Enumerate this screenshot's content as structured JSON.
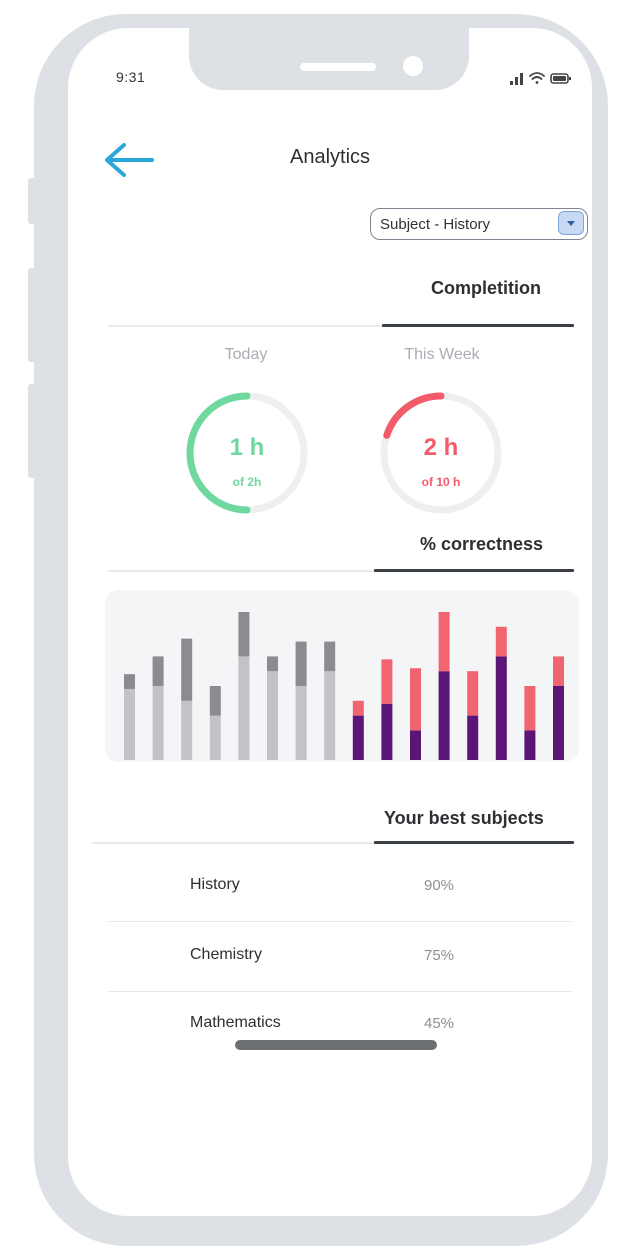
{
  "status_bar": {
    "time": "9:31",
    "icons": [
      "signal-icon",
      "wifi-icon",
      "battery-icon"
    ]
  },
  "header": {
    "title": "Analytics",
    "back_icon": "arrow-left-icon"
  },
  "subject_select": {
    "selected": "Subject - History"
  },
  "completion": {
    "title": "Completition",
    "today": {
      "label": "Today",
      "value": "1 h",
      "sub": "of 2h",
      "fraction": 0.5,
      "color": "#6fd89e"
    },
    "week": {
      "label": "This Week",
      "value": "2 h",
      "sub": "of 10 h",
      "fraction": 0.2,
      "color": "#f25c6a"
    }
  },
  "correctness": {
    "title": "% correctness"
  },
  "chart_data": {
    "type": "bar",
    "stacked": true,
    "axes_visible": false,
    "ylim": [
      0,
      100
    ],
    "groups": [
      {
        "name": "previous",
        "bar_count": 8,
        "colors": [
          "#c1c3c6",
          "#8a8c8f"
        ]
      },
      {
        "name": "current",
        "bar_count": 8,
        "colors": [
          "#5a1577",
          "#f16570"
        ]
      }
    ],
    "series": [
      {
        "values": [
          48,
          50,
          40,
          30,
          70,
          60,
          50,
          60,
          30,
          38,
          20,
          60,
          30,
          70,
          20,
          50
        ]
      },
      {
        "values": [
          10,
          20,
          42,
          20,
          30,
          10,
          30,
          20,
          10,
          30,
          42,
          40,
          30,
          20,
          30,
          20
        ]
      }
    ]
  },
  "best_subjects": {
    "title": "Your best subjects",
    "rows": [
      {
        "name": "History",
        "percent": "90%"
      },
      {
        "name": "Chemistry",
        "percent": "75%"
      },
      {
        "name": "Mathematics",
        "percent": "45%"
      }
    ]
  }
}
